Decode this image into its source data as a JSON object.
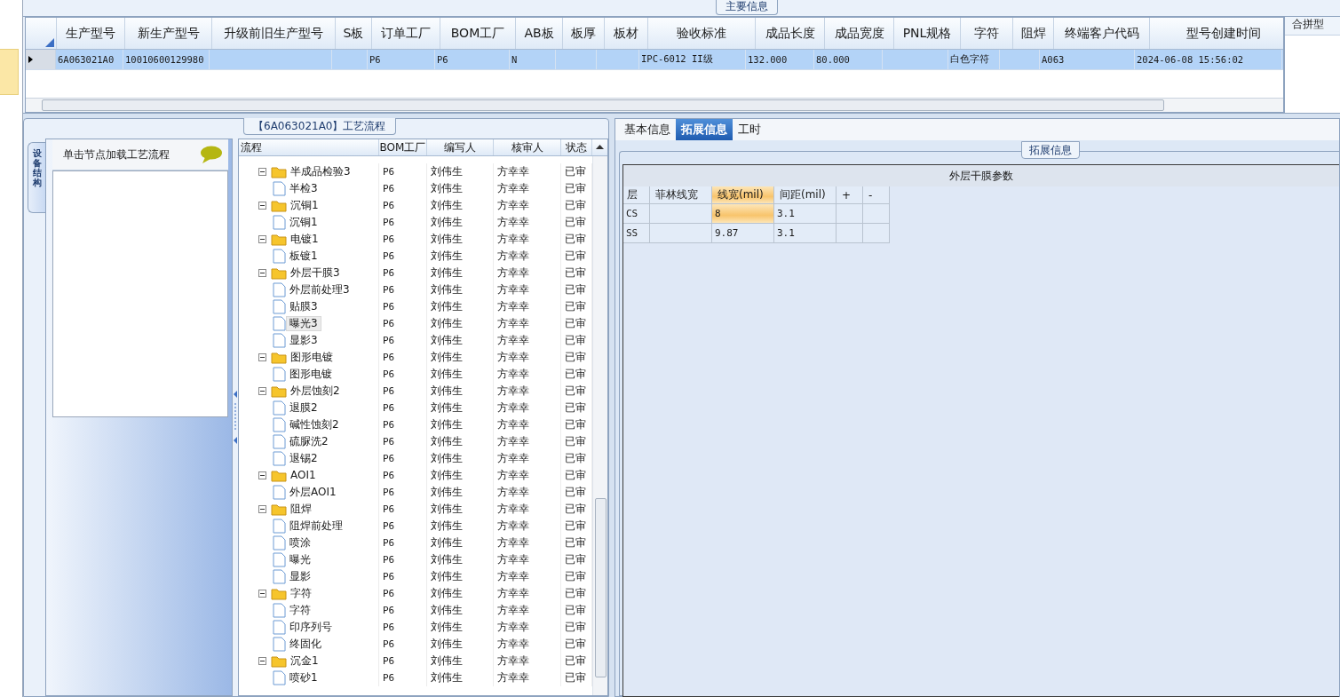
{
  "main_info": {
    "title": "主要信息",
    "columns": [
      "生产型号",
      "新生产型号",
      "升级前旧生产型号",
      "S板",
      "订单工厂",
      "BOM工厂",
      "AB板",
      "板厚",
      "板材",
      "验收标准",
      "成品长度",
      "成品宽度",
      "PNL规格",
      "字符",
      "阻焊",
      "终端客户代码",
      "型号创建时间"
    ],
    "rows": [
      {
        "selected": true,
        "cells": [
          "6A063021A0",
          "10010600129980",
          "",
          "",
          "P6",
          "P6",
          "N",
          "",
          "",
          "IPC-6012 II级",
          "132.000",
          "80.000",
          "",
          "白色字符",
          "",
          "A063",
          "2024-06-08 15:56:02"
        ]
      }
    ],
    "side_column": "合拼型"
  },
  "flow_panel": {
    "title": "【6A063021A0】工艺流程",
    "side_tab": "设备结构",
    "hint": "单击节点加载工艺流程",
    "columns": [
      "流程",
      "BOM工厂",
      "编写人",
      "核审人",
      "状态"
    ],
    "tree": [
      {
        "label": "半成品检验3",
        "bom": "P6",
        "author": "刘伟生",
        "reviewer": "方幸幸",
        "status": "已审",
        "expanded": true,
        "selected": false,
        "children": [
          {
            "label": "半检3",
            "bom": "P6",
            "author": "刘伟生",
            "reviewer": "方幸幸",
            "status": "已审",
            "selected": false
          }
        ]
      },
      {
        "label": "沉铜1",
        "bom": "P6",
        "author": "刘伟生",
        "reviewer": "方幸幸",
        "status": "已审",
        "expanded": true,
        "selected": false,
        "children": [
          {
            "label": "沉铜1",
            "bom": "P6",
            "author": "刘伟生",
            "reviewer": "方幸幸",
            "status": "已审",
            "selected": false
          }
        ]
      },
      {
        "label": "电镀1",
        "bom": "P6",
        "author": "刘伟生",
        "reviewer": "方幸幸",
        "status": "已审",
        "expanded": true,
        "selected": false,
        "children": [
          {
            "label": "板镀1",
            "bom": "P6",
            "author": "刘伟生",
            "reviewer": "方幸幸",
            "status": "已审",
            "selected": false
          }
        ]
      },
      {
        "label": "外层干膜3",
        "bom": "P6",
        "author": "刘伟生",
        "reviewer": "方幸幸",
        "status": "已审",
        "expanded": true,
        "selected": false,
        "children": [
          {
            "label": "外层前处理3",
            "bom": "P6",
            "author": "刘伟生",
            "reviewer": "方幸幸",
            "status": "已审",
            "selected": false
          },
          {
            "label": "贴膜3",
            "bom": "P6",
            "author": "刘伟生",
            "reviewer": "方幸幸",
            "status": "已审",
            "selected": false
          },
          {
            "label": "曝光3",
            "bom": "P6",
            "author": "刘伟生",
            "reviewer": "方幸幸",
            "status": "已审",
            "selected": true
          },
          {
            "label": "显影3",
            "bom": "P6",
            "author": "刘伟生",
            "reviewer": "方幸幸",
            "status": "已审",
            "selected": false
          }
        ]
      },
      {
        "label": "图形电镀",
        "bom": "P6",
        "author": "刘伟生",
        "reviewer": "方幸幸",
        "status": "已审",
        "expanded": true,
        "selected": false,
        "children": [
          {
            "label": "图形电镀",
            "bom": "P6",
            "author": "刘伟生",
            "reviewer": "方幸幸",
            "status": "已审",
            "selected": false
          }
        ]
      },
      {
        "label": "外层蚀刻2",
        "bom": "P6",
        "author": "刘伟生",
        "reviewer": "方幸幸",
        "status": "已审",
        "expanded": true,
        "selected": false,
        "children": [
          {
            "label": "退膜2",
            "bom": "P6",
            "author": "刘伟生",
            "reviewer": "方幸幸",
            "status": "已审",
            "selected": false
          },
          {
            "label": "碱性蚀刻2",
            "bom": "P6",
            "author": "刘伟生",
            "reviewer": "方幸幸",
            "status": "已审",
            "selected": false
          },
          {
            "label": "硫脲洗2",
            "bom": "P6",
            "author": "刘伟生",
            "reviewer": "方幸幸",
            "status": "已审",
            "selected": false
          },
          {
            "label": "退锡2",
            "bom": "P6",
            "author": "刘伟生",
            "reviewer": "方幸幸",
            "status": "已审",
            "selected": false
          }
        ]
      },
      {
        "label": "AOI1",
        "bom": "P6",
        "author": "刘伟生",
        "reviewer": "方幸幸",
        "status": "已审",
        "expanded": true,
        "selected": false,
        "children": [
          {
            "label": "外层AOI1",
            "bom": "P6",
            "author": "刘伟生",
            "reviewer": "方幸幸",
            "status": "已审",
            "selected": false
          }
        ]
      },
      {
        "label": "阻焊",
        "bom": "P6",
        "author": "刘伟生",
        "reviewer": "方幸幸",
        "status": "已审",
        "expanded": true,
        "selected": false,
        "children": [
          {
            "label": "阻焊前处理",
            "bom": "P6",
            "author": "刘伟生",
            "reviewer": "方幸幸",
            "status": "已审",
            "selected": false
          },
          {
            "label": "喷涂",
            "bom": "P6",
            "author": "刘伟生",
            "reviewer": "方幸幸",
            "status": "已审",
            "selected": false
          },
          {
            "label": "曝光",
            "bom": "P6",
            "author": "刘伟生",
            "reviewer": "方幸幸",
            "status": "已审",
            "selected": false
          },
          {
            "label": "显影",
            "bom": "P6",
            "author": "刘伟生",
            "reviewer": "方幸幸",
            "status": "已审",
            "selected": false
          }
        ]
      },
      {
        "label": "字符",
        "bom": "P6",
        "author": "刘伟生",
        "reviewer": "方幸幸",
        "status": "已审",
        "expanded": true,
        "selected": false,
        "children": [
          {
            "label": "字符",
            "bom": "P6",
            "author": "刘伟生",
            "reviewer": "方幸幸",
            "status": "已审",
            "selected": false
          },
          {
            "label": "印序列号",
            "bom": "P6",
            "author": "刘伟生",
            "reviewer": "方幸幸",
            "status": "已审",
            "selected": false
          },
          {
            "label": "终固化",
            "bom": "P6",
            "author": "刘伟生",
            "reviewer": "方幸幸",
            "status": "已审",
            "selected": false
          }
        ]
      },
      {
        "label": "沉金1",
        "bom": "P6",
        "author": "刘伟生",
        "reviewer": "方幸幸",
        "status": "已审",
        "expanded": true,
        "selected": false,
        "children": [
          {
            "label": "喷砂1",
            "bom": "P6",
            "author": "刘伟生",
            "reviewer": "方幸幸",
            "status": "已审",
            "selected": false
          }
        ]
      }
    ]
  },
  "detail_panel": {
    "tabs": [
      {
        "label": "基本信息",
        "selected": false
      },
      {
        "label": "拓展信息",
        "selected": true
      },
      {
        "label": "工时",
        "selected": false
      }
    ],
    "group_title": "拓展信息",
    "table_title": "外层干膜参数",
    "columns": [
      "层",
      "菲林线宽",
      "线宽(mil)",
      "间距(mil)",
      "+",
      "-"
    ],
    "rows": [
      {
        "cells": [
          {
            "text": "CS",
            "selected": false
          },
          {
            "text": "",
            "selected": false
          },
          {
            "text": "8",
            "selected": true
          },
          {
            "text": "3.1",
            "selected": false
          },
          {
            "text": "",
            "selected": false
          },
          {
            "text": "",
            "selected": false
          }
        ]
      },
      {
        "cells": [
          {
            "text": "SS",
            "selected": false
          },
          {
            "text": "",
            "selected": false
          },
          {
            "text": "9.87",
            "selected": false
          },
          {
            "text": "3.1",
            "selected": false
          },
          {
            "text": "",
            "selected": false
          },
          {
            "text": "",
            "selected": false
          }
        ]
      }
    ]
  }
}
